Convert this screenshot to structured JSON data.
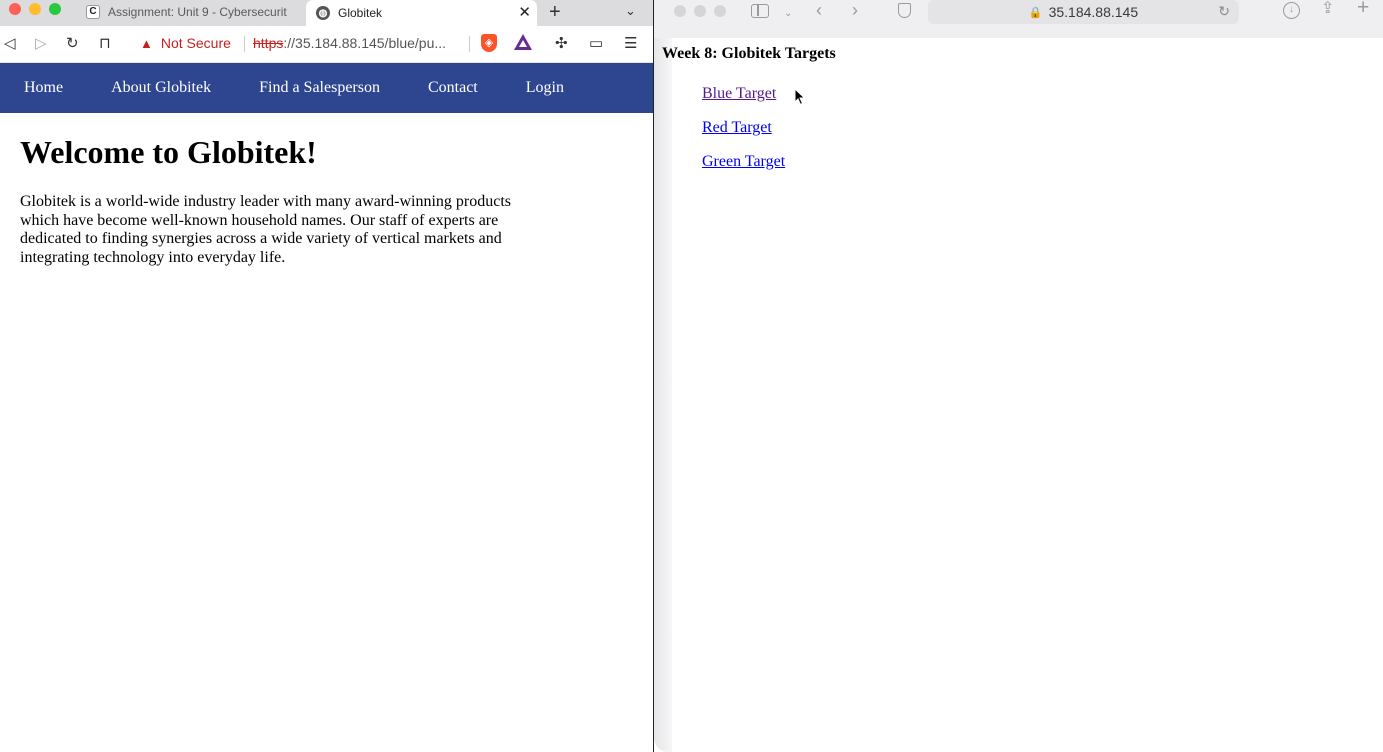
{
  "left_browser": {
    "tabs": [
      {
        "title": "Assignment: Unit 9 - Cybersecurit",
        "favicon": "C",
        "active": false
      },
      {
        "title": "Globitek",
        "favicon": "globe-icon",
        "active": true
      }
    ],
    "tab_close_glyph": "✕",
    "new_tab_glyph": "+",
    "tab_menu_glyph": "⌄",
    "toolbar": {
      "security_label": "Not Secure",
      "url_scheme": "https",
      "url_rest": "://35.184.88.145/blue/pu..."
    }
  },
  "globitek_site": {
    "nav": [
      "Home",
      "About Globitek",
      "Find a Salesperson",
      "Contact",
      "Login"
    ],
    "title": "Welcome to Globitek!",
    "paragraph": "Globitek is a world-wide industry leader with many award-winning products which have become well-known household names. Our staff of experts are dedicated to finding synergies across a wide variety of vertical markets and integrating technology into everyday life."
  },
  "right_browser": {
    "address": "35.184.88.145",
    "heading": "Week 8: Globitek Targets",
    "links": [
      {
        "label": "Blue Target",
        "visited": true
      },
      {
        "label": "Red Target",
        "visited": false
      },
      {
        "label": "Green Target",
        "visited": false
      }
    ]
  },
  "colors": {
    "nav_background": "#2e4690",
    "not_secure_red": "#c5221f",
    "visited_link": "#551a8b",
    "unvisited_link": "#0000ee"
  }
}
